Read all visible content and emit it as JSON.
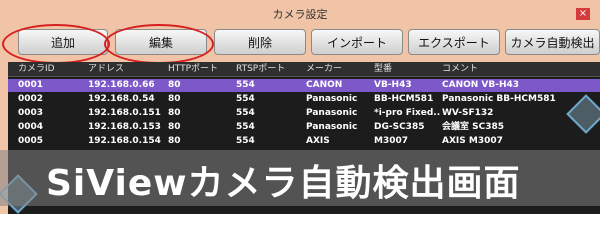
{
  "window": {
    "title": "カメラ設定",
    "close_label": "×"
  },
  "toolbar": {
    "buttons": [
      "追加",
      "編集",
      "削除",
      "インポート",
      "エクスポート",
      "カメラ自動検出"
    ]
  },
  "table": {
    "columns": [
      "カメラID",
      "アドレス",
      "HTTPポート",
      "RTSPポート",
      "メーカー",
      "型番",
      "コメント"
    ],
    "rows": [
      [
        "0001",
        "192.168.0.66",
        "80",
        "554",
        "CANON",
        "VB-H43",
        "CANON VB-H43"
      ],
      [
        "0002",
        "192.168.0.54",
        "80",
        "554",
        "Panasonic",
        "BB-HCM581",
        "Panasonic BB-HCM581"
      ],
      [
        "0003",
        "192.168.0.151",
        "80",
        "554",
        "Panasonic",
        "*i-pro Fixed...",
        "WV-SF132"
      ],
      [
        "0004",
        "192.168.0.153",
        "80",
        "554",
        "Panasonic",
        "DG-SC385",
        "会議室 SC385"
      ],
      [
        "0005",
        "192.168.0.154",
        "80",
        "554",
        "AXIS",
        "M3007",
        "AXIS M3007"
      ]
    ],
    "selected_row": 0
  },
  "caption": "SiViewカメラ自動検出画面",
  "colors": {
    "accent": "#7d58c8",
    "highlight_ring": "#d62020",
    "window_bg": "#f2c4a7"
  }
}
